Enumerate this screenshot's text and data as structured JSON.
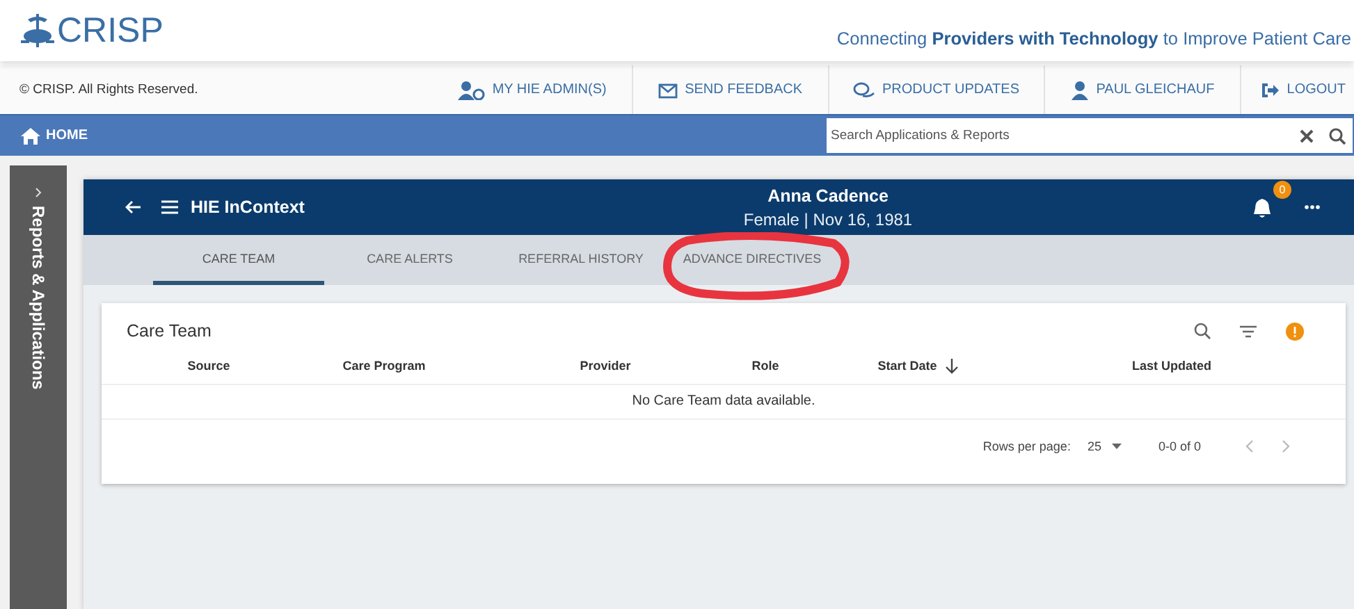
{
  "header": {
    "logo": "CRISP",
    "tagline": "Connecting **Providers with Technology** to Improve Patient Care"
  },
  "topbar": {
    "copyright": "© CRISP. All Rights Reserved.",
    "links": [
      {
        "label": "MY HIE ADMIN(S)",
        "kind": "admin"
      },
      {
        "label": "SEND FEEDBACK",
        "kind": "mail"
      },
      {
        "label": "PRODUCT UPDATES",
        "kind": "chat"
      },
      {
        "label": "PAUL GLEICHAUF",
        "kind": "user"
      },
      {
        "label": "LOGOUT",
        "kind": "logout"
      }
    ]
  },
  "nav": {
    "home": "HOME",
    "search": {
      "placeholder": "Search Applications & Reports"
    }
  },
  "sidebar": {
    "label": "Reports & Applications"
  },
  "app": {
    "title": "HIE InContext",
    "patient": {
      "name": "Anna Cadence",
      "info": "Female | Nov 16, 1981"
    },
    "badge": "0",
    "tabs": [
      {
        "label": "CARE TEAM",
        "selected": true
      },
      {
        "label": "CARE ALERTS",
        "selected": false
      },
      {
        "label": "REFERRAL HISTORY",
        "selected": false
      },
      {
        "label": "ADVANCE DIRECTIVES",
        "selected": false
      }
    ],
    "card": {
      "title": "Care Team",
      "columns": [
        {
          "label": "Source",
          "sorted": false
        },
        {
          "label": "Care Program",
          "sorted": false
        },
        {
          "label": "Provider",
          "sorted": false
        },
        {
          "label": "Role",
          "sorted": false
        },
        {
          "label": "Start Date",
          "sorted": true
        },
        {
          "label": "Last Updated",
          "sorted": false
        }
      ],
      "empty": "No Care Team data available.",
      "rows_per_page_label": "Rows per page:",
      "rows_per_page": "25",
      "range": "0-0 of 0"
    }
  }
}
